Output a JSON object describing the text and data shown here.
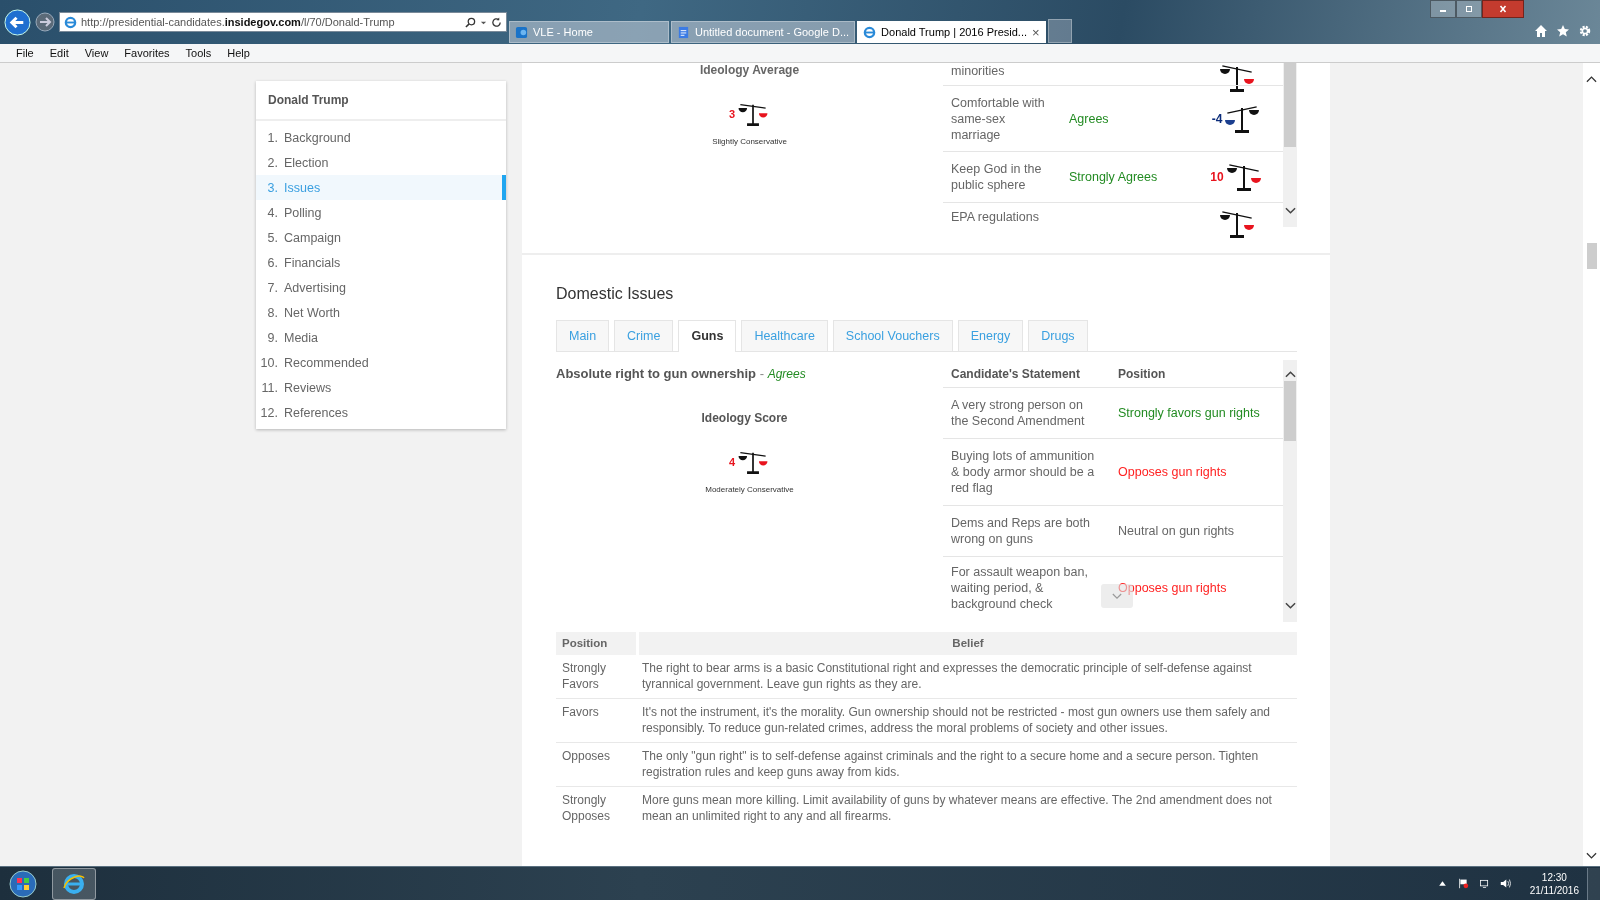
{
  "browser": {
    "url": "http://presidential-candidates.**insidegov.com**/l/70/Donald-Trump",
    "tabs": [
      {
        "title": "VLE - Home",
        "kind": "sharepoint",
        "selected": false
      },
      {
        "title": "Untitled document - Google D...",
        "kind": "document",
        "selected": false
      },
      {
        "title": "Donald Trump | 2016 Presid...",
        "kind": "browser",
        "selected": true
      }
    ],
    "close_glyph": "×",
    "menu": [
      "File",
      "Edit",
      "View",
      "Favorites",
      "Tools",
      "Help"
    ]
  },
  "sidebar": {
    "title": "Donald Trump",
    "items": [
      {
        "number": "1.",
        "label": "Background",
        "selected": false
      },
      {
        "number": "2.",
        "label": "Election",
        "selected": false
      },
      {
        "number": "3.",
        "label": "Issues",
        "selected": true
      },
      {
        "number": "4.",
        "label": "Polling",
        "selected": false
      },
      {
        "number": "5.",
        "label": "Campaign",
        "selected": false
      },
      {
        "number": "6.",
        "label": "Financials",
        "selected": false
      },
      {
        "number": "7.",
        "label": "Advertising",
        "selected": false
      },
      {
        "number": "8.",
        "label": "Net Worth",
        "selected": false
      },
      {
        "number": "9.",
        "label": "Media",
        "selected": false
      },
      {
        "number": "10.",
        "label": "Recommended",
        "selected": false
      },
      {
        "number": "11.",
        "label": "Reviews",
        "selected": false
      },
      {
        "number": "12.",
        "label": "References",
        "selected": false
      }
    ]
  },
  "ideology_average": {
    "title": "Ideology Average",
    "score": "3",
    "color": "#e8141e",
    "tips_left": false,
    "label": "Slightly Conservative"
  },
  "previous_issues": [
    {
      "statement": "minorities",
      "tips_left": false
    },
    {
      "statement": "Comfortable with same-sex marriage",
      "position": "Agrees",
      "color": "#228b22",
      "score": {
        "text": "-4",
        "color": "#0b2c7a"
      },
      "tips_left": true
    },
    {
      "statement": "Keep God in the public sphere",
      "position": "Strongly Agrees",
      "color": "#228b22",
      "score": {
        "text": "10",
        "color": "#e8141e"
      },
      "tips_left": false
    },
    {
      "statement": "EPA regulations",
      "tips_left": false
    }
  ],
  "domestic_issues": {
    "title": "Domestic Issues",
    "tabs": [
      {
        "label": "Main",
        "selected": false
      },
      {
        "label": "Crime",
        "selected": false
      },
      {
        "label": "Guns",
        "selected": true
      },
      {
        "label": "Healthcare",
        "selected": false
      },
      {
        "label": "School Vouchers",
        "selected": false
      },
      {
        "label": "Energy",
        "selected": false
      },
      {
        "label": "Drugs",
        "selected": false
      }
    ],
    "issue": {
      "title": "Absolute right to gun ownership",
      "separator": "-",
      "stance": "Agrees"
    },
    "ideology_score": {
      "title": "Ideology Score",
      "score": "4",
      "color": "#e8141e",
      "tips_left": false,
      "label": "Moderately Conservative"
    },
    "statements": {
      "columns": [
        "Candidate's Statement",
        "Position"
      ],
      "rows": [
        {
          "statement": "A very strong person on the Second Amendment",
          "position": "Strongly favors gun rights",
          "color": "#228b22"
        },
        {
          "statement": "Buying lots of ammunition & body armor should be a red flag",
          "position": "Opposes gun rights",
          "color": "#ff2222"
        },
        {
          "statement": "Dems and Reps are both wrong on guns",
          "position": "Neutral on gun rights",
          "color": "#666666"
        },
        {
          "statement": "For assault weapon ban, waiting period, & background check",
          "position": "Opposes gun rights",
          "color": "#ff2222"
        }
      ]
    },
    "beliefs": {
      "columns": [
        "Position",
        "Belief"
      ],
      "rows": [
        {
          "position": "Strongly Favors",
          "belief": "The right to bear arms is a basic Constitutional right and expresses the democratic principle of self-defense against tyrannical government. Leave gun rights as they are."
        },
        {
          "position": "Favors",
          "belief": "It's not the instrument, it's the morality. Gun ownership should not be restricted - most gun owners use them safely and responsibly. To reduce gun-related crimes, address the moral problems of society and other issues."
        },
        {
          "position": "Opposes",
          "belief": "The only \"gun right\" is to self-defense against criminals and the right to a secure home and a secure person. Tighten registration rules and keep guns away from kids."
        },
        {
          "position": "Strongly Opposes",
          "belief": "More guns mean more killing. Limit availability of guns by whatever means are effective. The 2nd amendment does not mean an unlimited right to any and all firearms."
        }
      ]
    }
  },
  "taskbar": {
    "time": "12:30",
    "date": "21/11/2016"
  }
}
